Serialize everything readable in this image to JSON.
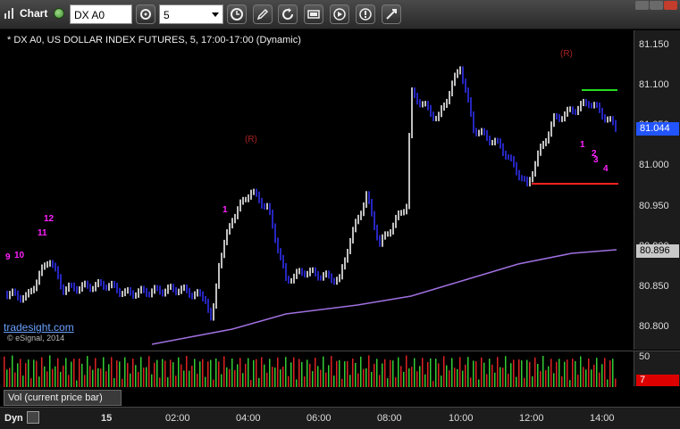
{
  "toolbar": {
    "app_title": "Chart",
    "symbol": "DX A0",
    "interval": "5"
  },
  "chart": {
    "header": "* DX A0, US DOLLAR INDEX FUTURES, 5, 17:00-17:00 (Dynamic)",
    "copyright": "© eSignal, 2014",
    "watermark": "tradesight.com",
    "price_ticks": [
      "81.150",
      "81.100",
      "81.050",
      "81.000",
      "80.950",
      "80.900",
      "80.850",
      "80.800"
    ],
    "current_price": "81.044",
    "ma_price": "80.896",
    "colors": {
      "up_bar": "#ffffff",
      "down_bar": "#3333ff",
      "ma_line": "#a070e0",
      "current_badge": "#2255ff",
      "ma_badge": "#c8c8c8",
      "annotation_yellow": "#ffff33",
      "annotation_magenta": "#ff22ff",
      "annotation_green": "#33cc33",
      "reversal": "#aa2222",
      "resistance": "#22dd22",
      "support": "#ff2222"
    },
    "annotations": [
      {
        "text": "9",
        "color": "magenta"
      },
      {
        "text": "10",
        "color": "magenta"
      },
      {
        "text": "11",
        "color": "magenta"
      },
      {
        "text": "12",
        "color": "magenta"
      },
      {
        "text": "(R)",
        "color": "reversal"
      },
      {
        "text": "(R)",
        "color": "reversal"
      },
      {
        "text": "1",
        "color": "magenta"
      },
      {
        "text": "1",
        "color": "magenta"
      },
      {
        "text": "2",
        "color": "magenta"
      },
      {
        "text": "3",
        "color": "magenta"
      },
      {
        "text": "4",
        "color": "magenta"
      }
    ]
  },
  "volume": {
    "label": "Vol (current price bar)",
    "ticks": [
      "50",
      "7"
    ]
  },
  "time_axis": {
    "dyn_label": "Dyn",
    "ticks": [
      "15",
      "02:00",
      "04:00",
      "06:00",
      "08:00",
      "10:00",
      "12:00",
      "14:00"
    ]
  }
}
